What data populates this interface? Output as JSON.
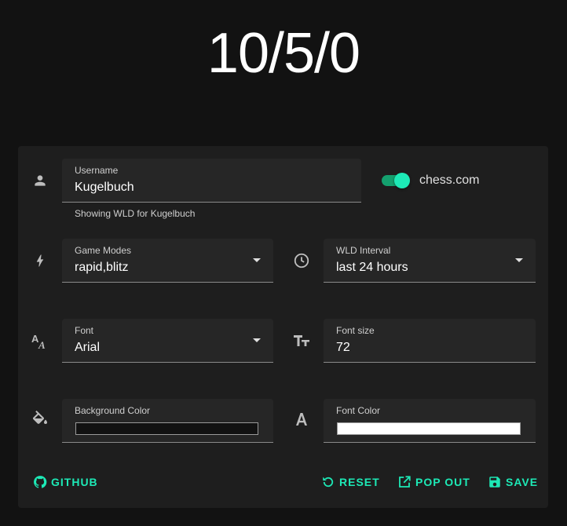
{
  "score": "10/5/0",
  "colors": {
    "accent": "#1de9b6",
    "panel": "#1e1e1e",
    "background": "#121212"
  },
  "username": {
    "label": "Username",
    "value": "Kugelbuch",
    "helper": "Showing WLD for Kugelbuch"
  },
  "platform_toggle": {
    "label": "chess.com",
    "checked": true
  },
  "game_modes": {
    "label": "Game Modes",
    "value": "rapid,blitz"
  },
  "wld_interval": {
    "label": "WLD Interval",
    "value": "last 24 hours"
  },
  "font": {
    "label": "Font",
    "value": "Arial"
  },
  "font_size": {
    "label": "Font size",
    "value": "72"
  },
  "background_color": {
    "label": "Background Color",
    "value": "#121212"
  },
  "font_color": {
    "label": "Font Color",
    "value": "#ffffff"
  },
  "actions": {
    "github": "GITHUB",
    "reset": "RESET",
    "pop_out": "POP OUT",
    "save": "SAVE"
  },
  "icons": [
    "person-icon",
    "bolt-icon",
    "clock-icon",
    "font-family-icon",
    "font-size-icon",
    "paint-bucket-icon",
    "font-color-icon",
    "github-icon",
    "reset-icon",
    "pop-out-icon",
    "save-icon"
  ]
}
